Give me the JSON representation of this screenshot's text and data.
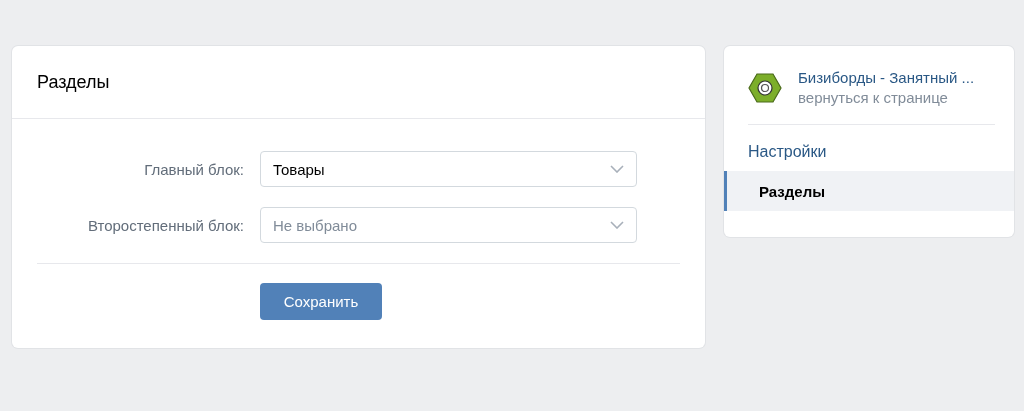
{
  "main": {
    "title": "Разделы",
    "fields": [
      {
        "label": "Главный блок:",
        "value": "Товары"
      },
      {
        "label": "Второстепенный блок:",
        "placeholder": "Не выбрано"
      }
    ],
    "save_button": "Сохранить"
  },
  "sidebar": {
    "community": {
      "name": "Бизиборды - Занятный ...",
      "link": "вернуться к странице"
    },
    "section_title": "Настройки",
    "items": [
      {
        "label": "Разделы",
        "selected": true
      }
    ]
  }
}
